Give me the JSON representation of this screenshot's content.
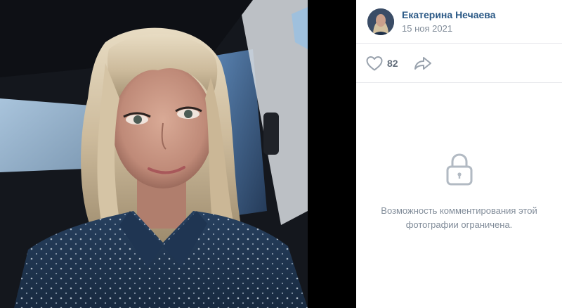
{
  "author": {
    "name": "Екатерина Нечаева",
    "date": "15 ноя 2021"
  },
  "actions": {
    "like_count": "82",
    "like_icon": "heart-outline",
    "share_icon": "share-arrow"
  },
  "comments": {
    "closed_message": "Возможность комментирования этой фотографии ограничена.",
    "icon": "lock"
  },
  "colors": {
    "author_link": "#2a5885",
    "secondary_text": "#818c99",
    "icon_gray": "#99a2ad",
    "divider": "#e7e8ec"
  }
}
